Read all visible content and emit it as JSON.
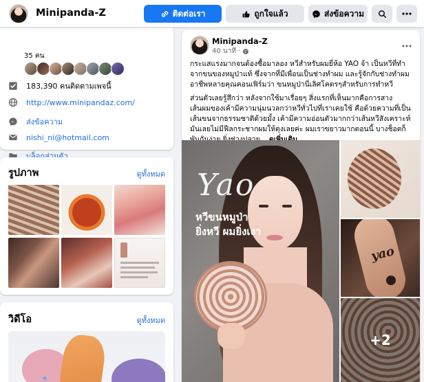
{
  "header": {
    "page_name": "Minipanda-Z",
    "contact_label": "ติดต่อเรา",
    "like_label": "ถูกใจแล้ว",
    "message_label": "ส่งข้อความ"
  },
  "about": {
    "friends_count": "35 คน",
    "followers": "183,390 คนติดตามเพจนี้",
    "website": "http://www.minipandaz.com/",
    "send_message": "ส่งข้อความ",
    "email": "nishi_ni@hotmail.com",
    "blog": "บล็อกส่วนตัว"
  },
  "photos": {
    "title": "รูปภาพ",
    "see_all": "ดูทั้งหมด"
  },
  "videos": {
    "title": "วิดีโอ",
    "see_all": "ดูทั้งหมด"
  },
  "post": {
    "author": "Minipanda-Z",
    "time": "40 นาที",
    "paragraph1": "กระแสแรงมากจนต้องซื้อมาลอง หวีสำหรับผมยี่ห้อ YAO จ้า เป็นหวีที่ทำจากขนของหมูป่าแท้ ซึ่งจากที่มีเพื่อนเป็นช่างทำผม และรู้จักกับช่างทำผมอาชีพหลายคุณคอนเฟิร์มว่า ขนหมูป่านี่เลิศโคตรๆสำหรับการทำหวี",
    "paragraph2": "ส่วนตัวเลยรู้สึกว่า หลังจากใช้มาเรื่อยๆ สิ่งแรกที่เห็นมากคือการสางเส้นผมของเค้ามีความนุ่มนวลกว่าหวีทั่วไปที่เราเคยใช้ คือด้วยความที่เป็นเส้นขนจากธรรมชาติด้วยมั้ง เค้ามีความอ่อนตัวมากกว่าเส้นหวีสังเคราะห์ มันเลยไม่มีฟีลกระชากผมให้ตุงเลยค่ะ ผมเราขยาวมากตอนนี้ บางช็อตก็พันกันง่าย ยิ่งช่วงปลาย...",
    "see_more": "ดูเพิ่มเติม",
    "overlay_text_brand": "Yao",
    "overlay_text_line1": "หวีขนหมูป่า",
    "overlay_text_line2": "ยิ่งหวี ผมยิ่งเงา",
    "brush_engraving": "yao",
    "more_photos": "+2"
  },
  "colors": {
    "accent": "#1877f2",
    "link": "#216fdb",
    "muted": "#65676b",
    "bg": "#f0f2f5"
  }
}
